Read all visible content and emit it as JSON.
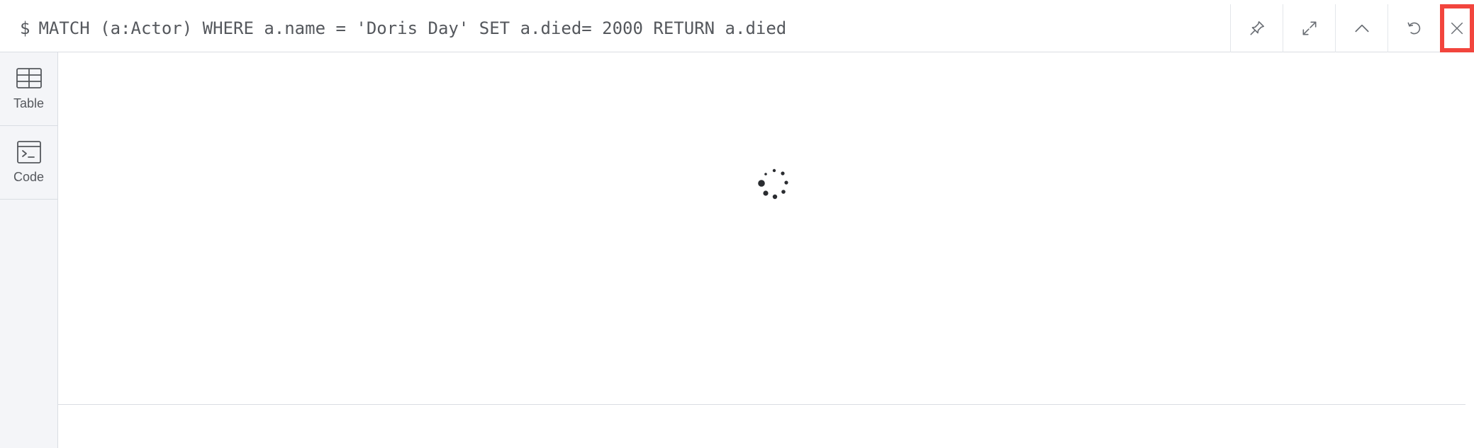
{
  "query": {
    "prompt": "$",
    "text": "MATCH (a:Actor) WHERE a.name = 'Doris Day' SET a.died= 2000 RETURN a.died"
  },
  "header_actions": [
    {
      "name": "pin-button",
      "icon": "pin-icon"
    },
    {
      "name": "expand-button",
      "icon": "expand-icon"
    },
    {
      "name": "collapse-button",
      "icon": "chevron-up-icon"
    },
    {
      "name": "rerun-button",
      "icon": "refresh-icon"
    },
    {
      "name": "close-button",
      "icon": "close-icon"
    }
  ],
  "sidebar": {
    "items": [
      {
        "label": "Table",
        "icon": "table-icon"
      },
      {
        "label": "Code",
        "icon": "terminal-icon"
      }
    ]
  },
  "status": {
    "loading_indicator": "loading-spinner-icon"
  },
  "colors": {
    "highlight": "#f2453d",
    "sidebar_bg": "#f4f5f8",
    "text": "#55585d",
    "border": "#dadde3"
  }
}
